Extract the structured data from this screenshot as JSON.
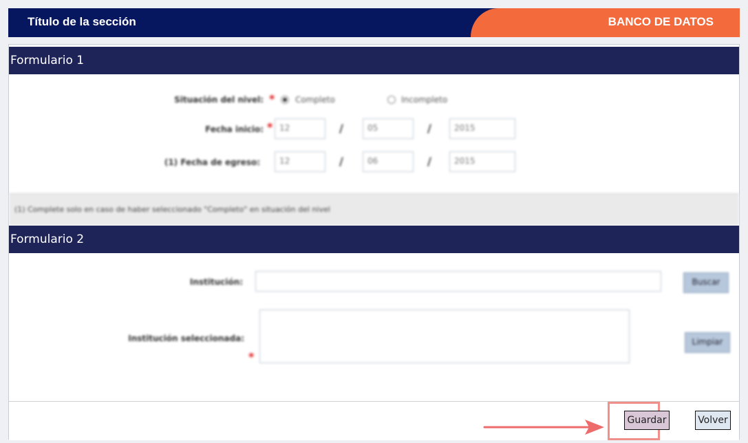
{
  "header": {
    "section_title": "Título de la sección",
    "brand": "BANCO DE DATOS"
  },
  "form1": {
    "title": "Formulario 1",
    "nivel_label": "Situación del nivel:",
    "option_complete": "Completo",
    "option_incomplete": "Incompleto",
    "fecha_inicio_label": "Fecha inicio:",
    "fecha_inicio": {
      "day": "12",
      "month": "05",
      "year": "2015"
    },
    "fecha_egreso_label": "(1) Fecha de egreso:",
    "fecha_egreso": {
      "day": "12",
      "month": "06",
      "year": "2015"
    },
    "date_separator": "/",
    "required_mark": "*",
    "note": "(1) Complete solo en caso de haber seleccionado \"Completo\" en situación del nivel"
  },
  "form2": {
    "title": "Formulario 2",
    "institucion_label": "Institución:",
    "buscar": "Buscar",
    "seleccionada_label": "Institución seleccionada:",
    "limpiar": "Limpiar"
  },
  "footer": {
    "guardar": "Guardar",
    "volver": "Volver"
  },
  "colors": {
    "header_navy": "#07175f",
    "section_bar": "#1e2358",
    "brand_orange": "#f36b3c",
    "highlight": "#f0908a",
    "arrow": "#ee6b6b"
  }
}
